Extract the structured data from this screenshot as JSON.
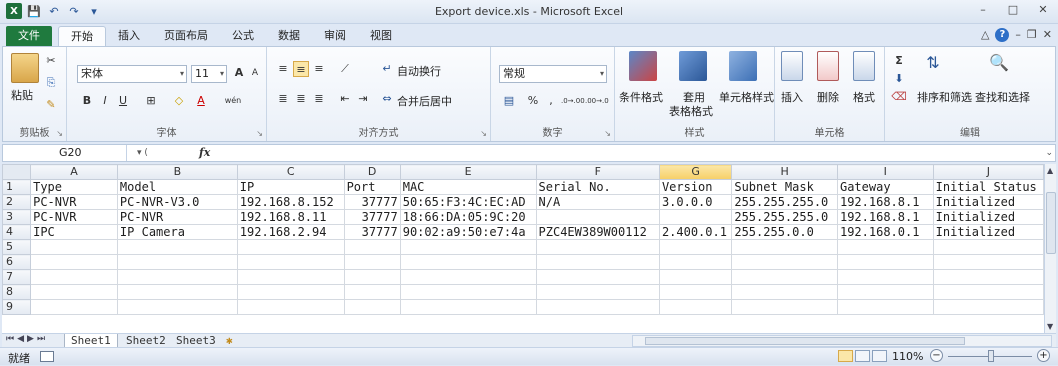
{
  "window": {
    "title": "Export device.xls - Microsoft Excel",
    "min": "–",
    "max": "□",
    "close": "✕"
  },
  "qat": {
    "logo": "X",
    "save": "💾",
    "undo": "↶",
    "redo": "↷",
    "more": "▾"
  },
  "tabs": [
    "文件",
    "开始",
    "插入",
    "页面布局",
    "公式",
    "数据",
    "审阅",
    "视图"
  ],
  "ribbon": {
    "clipboard": {
      "paste": "粘贴",
      "label": "剪贴板"
    },
    "font": {
      "name": "宋体",
      "size": "11",
      "grow": "A",
      "shrink": "A",
      "bold": "B",
      "italic": "I",
      "underline": "U",
      "border": "⊞",
      "fill": "◇",
      "color": "A",
      "phonetic": "wén",
      "label": "字体"
    },
    "align": {
      "wrap": "自动换行",
      "merge": "合并后居中",
      "label": "对齐方式"
    },
    "number": {
      "format": "常规",
      "percent": "%",
      "comma": ",",
      "inc": ".0→.00",
      "dec": ".00→.0",
      "label": "数字"
    },
    "styles": {
      "cond": "条件格式",
      "table_a": "套用",
      "table_b": "表格格式",
      "cell": "单元格样式",
      "label": "样式"
    },
    "cells": {
      "insert": "插入",
      "delete": "删除",
      "format": "格式",
      "label": "单元格"
    },
    "edit": {
      "sum": "Σ",
      "sort": "排序和筛选",
      "find": "查找和选择",
      "label": "编辑"
    }
  },
  "formula": {
    "cell": "G20",
    "fx": "fx",
    "value": ""
  },
  "columns": [
    "A",
    "B",
    "C",
    "D",
    "E",
    "F",
    "G",
    "H",
    "I",
    "J"
  ],
  "rows": [
    [
      "Type",
      "Model",
      "IP",
      "Port",
      "MAC",
      "Serial No.",
      "Version",
      "Subnet Mask",
      "Gateway",
      "Initial Status"
    ],
    [
      "PC-NVR",
      "PC-NVR-V3.0",
      "192.168.8.152",
      "37777",
      "50:65:F3:4C:EC:AD",
      "N/A",
      "3.0.0.0",
      "255.255.255.0",
      "192.168.8.1",
      "Initialized"
    ],
    [
      "PC-NVR",
      "PC-NVR",
      "192.168.8.11",
      "37777",
      "18:66:DA:05:9C:20",
      "",
      "",
      "255.255.255.0",
      "192.168.8.1",
      "Initialized"
    ],
    [
      "IPC",
      "IP Camera",
      "192.168.2.94",
      "37777",
      "90:02:a9:50:e7:4a",
      "PZC4EW389W00112",
      "2.400.0.1",
      "255.255.0.0",
      "192.168.0.1",
      "Initialized"
    ],
    [
      "",
      "",
      "",
      "",
      "",
      "",
      "",
      "",
      "",
      ""
    ],
    [
      "",
      "",
      "",
      "",
      "",
      "",
      "",
      "",
      "",
      ""
    ],
    [
      "",
      "",
      "",
      "",
      "",
      "",
      "",
      "",
      "",
      ""
    ],
    [
      "",
      "",
      "",
      "",
      "",
      "",
      "",
      "",
      "",
      ""
    ],
    [
      "",
      "",
      "",
      "",
      "",
      "",
      "",
      "",
      "",
      ""
    ]
  ],
  "row_numbers": [
    "1",
    "2",
    "3",
    "4",
    "5",
    "6",
    "7",
    "8",
    "9"
  ],
  "sheets": [
    "Sheet1",
    "Sheet2",
    "Sheet3"
  ],
  "status": {
    "mode": "就绪",
    "zoom": "110%"
  }
}
